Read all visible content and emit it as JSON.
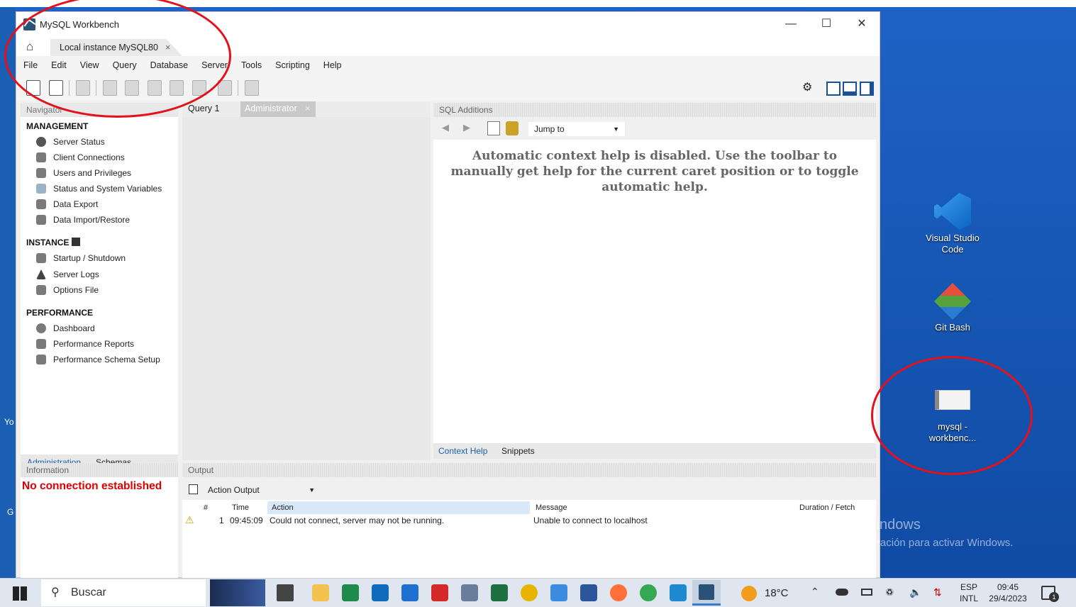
{
  "window": {
    "title": "MySQL Workbench",
    "connection_tab": "Local instance MySQL80",
    "tab_close": "×",
    "controls": {
      "minimize": "—",
      "maximize": "☐",
      "close": "✕"
    }
  },
  "menu": [
    "File",
    "Edit",
    "View",
    "Query",
    "Database",
    "Server",
    "Tools",
    "Scripting",
    "Help"
  ],
  "navigator": {
    "header": "Navigator",
    "management_title": "MANAGEMENT",
    "management": [
      "Server Status",
      "Client Connections",
      "Users and Privileges",
      "Status and System Variables",
      "Data Export",
      "Data Import/Restore"
    ],
    "instance_title": "INSTANCE",
    "instance": [
      "Startup / Shutdown",
      "Server Logs",
      "Options File"
    ],
    "performance_title": "PERFORMANCE",
    "performance": [
      "Dashboard",
      "Performance Reports",
      "Performance Schema Setup"
    ],
    "tabs": {
      "administration": "Administration",
      "schemas": "Schemas"
    }
  },
  "editor_tabs": {
    "query": "Query 1",
    "admin": "Administrator",
    "close": "×"
  },
  "sql_additions": {
    "header": "SQL Additions",
    "jump_to": "Jump to",
    "help_text": "Automatic context help is disabled. Use the toolbar to manually get help for the current caret position or to toggle automatic help.",
    "tabs": {
      "context_help": "Context Help",
      "snippets": "Snippets"
    }
  },
  "information": {
    "header": "Information",
    "status": "No connection established"
  },
  "output": {
    "header": "Output",
    "select": "Action Output",
    "columns": {
      "num": "#",
      "time": "Time",
      "action": "Action",
      "message": "Message",
      "duration": "Duration / Fetch"
    },
    "rows": [
      {
        "num": "1",
        "time": "09:45:09",
        "action": "Could not connect, server may not be running.",
        "message": "Unable to connect to localhost",
        "duration": ""
      }
    ]
  },
  "desktop": {
    "icons": [
      {
        "label": "Visual Studio Code",
        "icon": "vscode-icon"
      },
      {
        "label": "Git Bash",
        "icon": "git-bash-icon"
      },
      {
        "label": "mysql - workbenc...",
        "icon": "workbench-shortcut-icon"
      }
    ],
    "watermark_title": "Activar Windows",
    "watermark_sub": "Ve a Configuración para activar Windows.",
    "left_edge_1": "Yo",
    "left_edge_2": "G"
  },
  "taskbar": {
    "search_placeholder": "Buscar",
    "weather": "18°C",
    "lang_top": "ESP",
    "lang_bottom": "INTL",
    "time": "09:45",
    "date": "29/4/2023",
    "notification_count": "1"
  },
  "colors": {
    "annotation_circle": "#e4101a",
    "desktop_blue": "#1a5fb4",
    "error_text": "#dd0000",
    "link_blue": "#1a5fa8"
  }
}
